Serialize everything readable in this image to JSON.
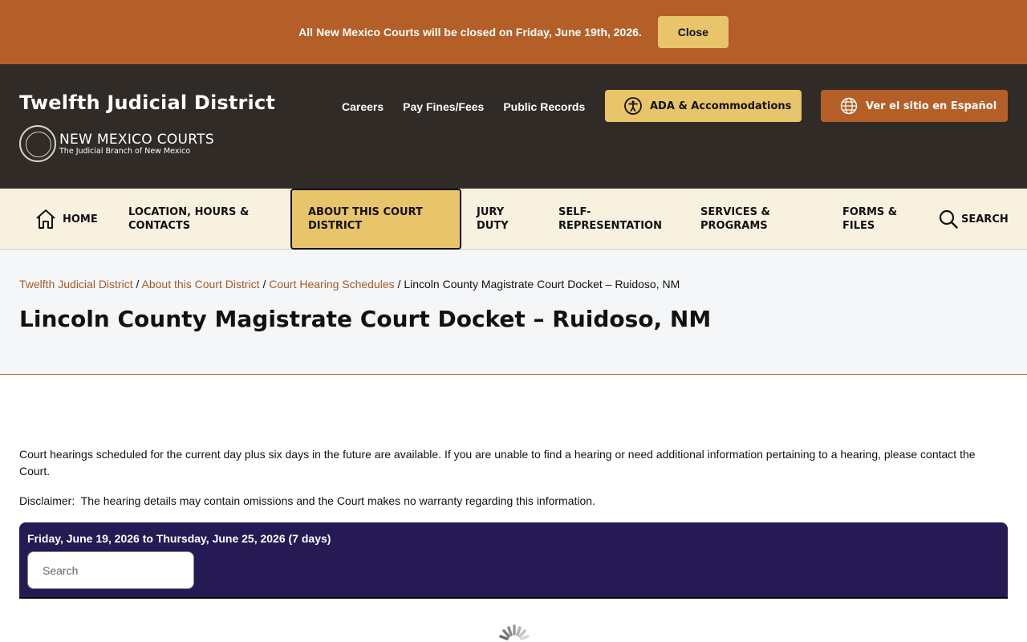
{
  "alert": {
    "message": "All New Mexico Courts will be closed on Friday, June 19th, 2026.",
    "close_label": "Close"
  },
  "header": {
    "site_title": "Twelfth Judicial District",
    "logo_main": "NEW MEXICO COURTS",
    "logo_sub": "The Judicial Branch of New Mexico",
    "util_links": [
      "Careers",
      "Pay Fines/Fees",
      "Public Records"
    ],
    "ada_label": "ADA & Accommodations",
    "spanish_label": "Ver el sitio en Español"
  },
  "nav": {
    "home": "HOME",
    "location": "LOCATION, HOURS & CONTACTS",
    "about": "ABOUT THIS COURT DISTRICT",
    "jury": "JURY DUTY",
    "self_rep": "SELF-REPRESENTATION",
    "services": "SERVICES & PROGRAMS",
    "forms": "FORMS & FILES",
    "search": "SEARCH"
  },
  "breadcrumb": {
    "items": [
      "Twelfth Judicial District",
      "About this Court District",
      "Court Hearing Schedules"
    ],
    "current": "Lincoln County Magistrate Court Docket – Ruidoso, NM",
    "separator": " / "
  },
  "page": {
    "title": "Lincoln County Magistrate Court Docket – Ruidoso, NM",
    "intro": "Court hearings scheduled for the current day plus six days in the future are available. If you are unable to find a hearing or need additional information pertaining to a hearing, please contact the Court.",
    "disclaimer": "Disclaimer:  The hearing details may contain omissions and the Court makes no warranty regarding this information."
  },
  "docket": {
    "range": "Friday, June 19, 2026 to Thursday, June 25, 2026 (7 days)",
    "search_placeholder": "Search"
  },
  "colors": {
    "alert_bg": "#b45f27",
    "header_bg": "#312b27",
    "accent_gold": "#e8c46a",
    "nav_bg": "#f8f1e0",
    "docket_bg": "#261a55",
    "link": "#a65a25"
  }
}
